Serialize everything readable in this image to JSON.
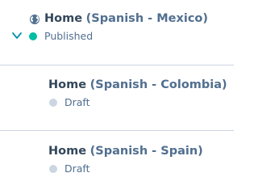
{
  "pages": [
    {
      "name": "Home",
      "variant": "(Spanish - Mexico)",
      "status": "Published",
      "status_color": "#00bda5",
      "expanded": true
    },
    {
      "name": "Home",
      "variant": "(Spanish - Colombia)",
      "status": "Draft",
      "status_color": "#cbd6e2"
    },
    {
      "name": "Home",
      "variant": "(Spanish - Spain)",
      "status": "Draft",
      "status_color": "#cbd6e2"
    }
  ],
  "icons": {
    "expand": "chevron-down-icon",
    "language": "globe-icon"
  },
  "colors": {
    "title": "#33475b",
    "muted": "#516f90",
    "chevron": "#0091ae",
    "divider": "#cbd6e2"
  }
}
